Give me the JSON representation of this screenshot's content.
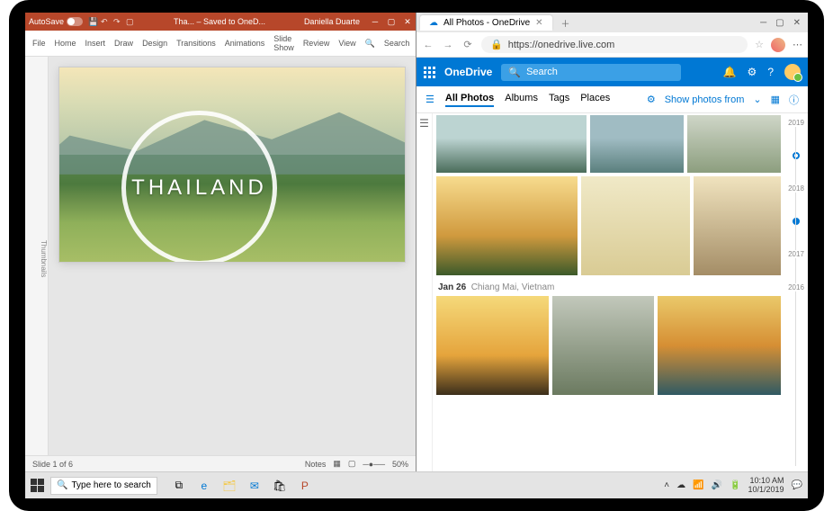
{
  "taskbar": {
    "search_placeholder": "Type here to search",
    "time": "10:10 AM",
    "date": "10/1/2019"
  },
  "ppt": {
    "autosave_label": "AutoSave",
    "doc_title": "Tha... – Saved to OneD...",
    "user": "Daniella Duarte",
    "ribbon": {
      "file": "File",
      "home": "Home",
      "insert": "Insert",
      "draw": "Draw",
      "design": "Design",
      "transitions": "Transitions",
      "animations": "Animations",
      "slideshow": "Slide Show",
      "review": "Review",
      "view": "View",
      "search": "Search"
    },
    "thumbnails_label": "Thumbnails",
    "slide_title": "THAILAND",
    "status": {
      "slide": "Slide 1 of 6",
      "notes": "Notes",
      "zoom": "50%"
    }
  },
  "edge": {
    "tab_title": "All Photos - OneDrive",
    "url": "https://onedrive.live.com"
  },
  "onedrive": {
    "brand": "OneDrive",
    "search_placeholder": "Search",
    "tabs": {
      "all": "All Photos",
      "albums": "Albums",
      "tags": "Tags",
      "places": "Places"
    },
    "show_from": "Show photos from",
    "date_header": "Jan 26",
    "date_location": "Chiang Mai, Vietnam",
    "years": {
      "y1": "2019",
      "y2": "2018",
      "y3": "2017",
      "y4": "2016"
    }
  }
}
